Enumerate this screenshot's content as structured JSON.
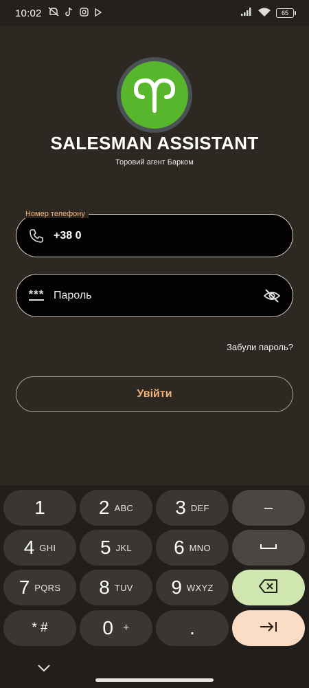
{
  "status_bar": {
    "time": "10:02",
    "battery": "65",
    "icons": [
      "mute-icon",
      "tiktok-icon",
      "instagram-icon",
      "play-icon",
      "signal-icon",
      "wifi-icon",
      "battery-icon"
    ]
  },
  "app": {
    "title": "SALESMAN ASSISTANT",
    "subtitle": "Торовий агент Барком",
    "logo": "aries-logo-icon",
    "accent_color": "#57b62c"
  },
  "form": {
    "phone_label": "Номер телефону",
    "phone_value": "+38 0",
    "password_placeholder": "Пароль",
    "password_dots": "***",
    "forgot_link": "Забули пароль?",
    "login_button": "Увійти",
    "label_color": "#f4b27a"
  },
  "keyboard": {
    "keys": [
      {
        "num": "1",
        "letters": ""
      },
      {
        "num": "2",
        "letters": "ABC"
      },
      {
        "num": "3",
        "letters": "DEF"
      },
      {
        "num": "4",
        "letters": "GHI"
      },
      {
        "num": "5",
        "letters": "JKL"
      },
      {
        "num": "6",
        "letters": "MNO"
      },
      {
        "num": "7",
        "letters": "PQRS"
      },
      {
        "num": "8",
        "letters": "TUV"
      },
      {
        "num": "9",
        "letters": "WXYZ"
      },
      {
        "num": "* #",
        "letters": ""
      },
      {
        "num": "0",
        "letters": "+"
      },
      {
        "num": ".",
        "letters": ""
      }
    ],
    "minus": "–"
  }
}
